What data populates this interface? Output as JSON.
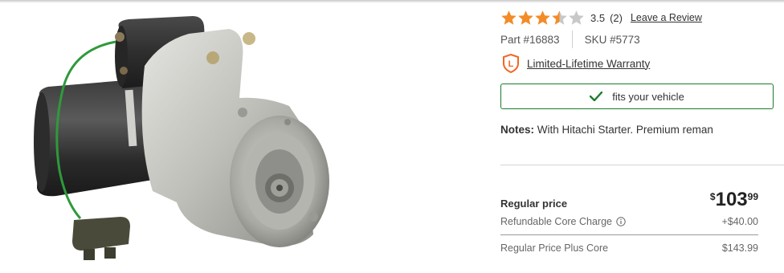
{
  "product_image": {
    "alt": "Starter motor",
    "icon": "starter-motor-image"
  },
  "rating": {
    "value": "3.5",
    "count": "(2)",
    "review_link": "Leave a Review",
    "stars_filled": 3.5,
    "stars_total": 5,
    "star_color": "#f28c28",
    "empty_star_color": "#c8c8c8"
  },
  "identifiers": {
    "part": "Part #16883",
    "sku": "SKU #5773"
  },
  "warranty": {
    "label": "Limited-Lifetime Warranty",
    "badge_letter": "L",
    "badge_color": "#f26722"
  },
  "fitment": {
    "label": "fits your vehicle",
    "color": "#1a7d2b"
  },
  "notes": {
    "heading": "Notes:",
    "text": "With Hitachi Starter. Premium reman"
  },
  "pricing": {
    "regular_label": "Regular price",
    "currency": "$",
    "dollars": "103",
    "cents": "99",
    "core_label": "Refundable Core Charge",
    "core_value": "+$40.00",
    "plus_core_label": "Regular Price Plus Core",
    "plus_core_value": "$143.99"
  }
}
